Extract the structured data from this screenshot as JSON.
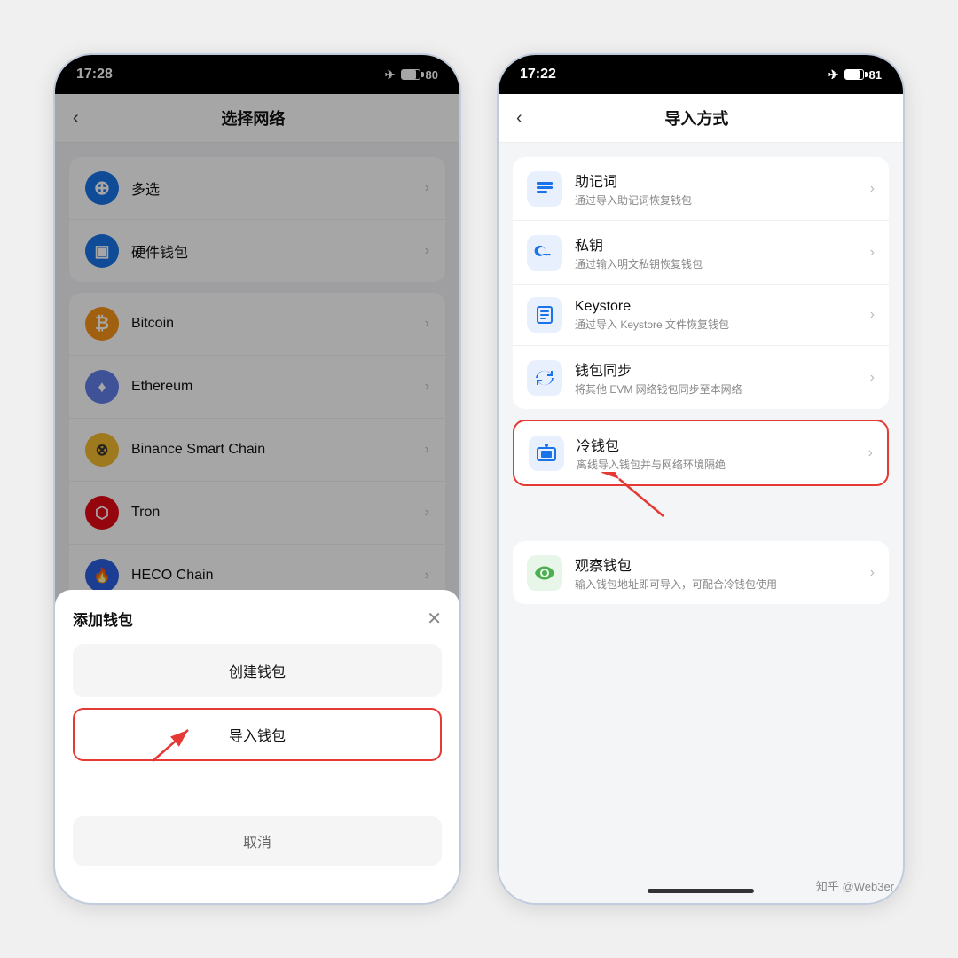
{
  "left_phone": {
    "status": {
      "time": "17:28",
      "battery": "80",
      "airplane": true
    },
    "nav_title": "选择网络",
    "back_label": "‹",
    "networks": [
      {
        "id": "multi",
        "label": "多选",
        "icon_bg": "#1a73e8",
        "icon_text": "⊕"
      },
      {
        "id": "hardware",
        "label": "硬件钱包",
        "icon_bg": "#1a73e8",
        "icon_text": "▣"
      },
      {
        "id": "bitcoin",
        "label": "Bitcoin",
        "icon_bg": "#f7931a",
        "icon_text": "₿"
      },
      {
        "id": "ethereum",
        "label": "Ethereum",
        "icon_bg": "#627eea",
        "icon_text": "♦"
      },
      {
        "id": "bsc",
        "label": "Binance Smart Chain",
        "icon_bg": "#f3ba2f",
        "icon_text": "⊗"
      },
      {
        "id": "tron",
        "label": "Tron",
        "icon_bg": "#e50915",
        "icon_text": "⬡"
      },
      {
        "id": "heco",
        "label": "HECO Chain",
        "icon_bg": "#2a5fe0",
        "icon_text": "🔥"
      }
    ],
    "bottom_sheet": {
      "title": "添加钱包",
      "create_label": "创建钱包",
      "import_label": "导入钱包",
      "cancel_label": "取消",
      "close_icon": "✕"
    }
  },
  "right_phone": {
    "status": {
      "time": "17:22",
      "battery": "81",
      "airplane": true
    },
    "nav_title": "导入方式",
    "back_label": "‹",
    "methods_group1": [
      {
        "id": "mnemonic",
        "title": "助记词",
        "desc": "通过导入助记词恢复钱包",
        "icon_bg": "#1a73e8",
        "icon_color": "#fff"
      },
      {
        "id": "privatekey",
        "title": "私钥",
        "desc": "通过输入明文私钥恢复钱包",
        "icon_bg": "#1a73e8",
        "icon_color": "#fff"
      },
      {
        "id": "keystore",
        "title": "Keystore",
        "desc": "通过导入 Keystore 文件恢复钱包",
        "icon_bg": "#1a73e8",
        "icon_color": "#fff"
      },
      {
        "id": "walletSync",
        "title": "钱包同步",
        "desc": "将其他 EVM 网络钱包同步至本网络",
        "icon_bg": "#1a73e8",
        "icon_color": "#fff"
      }
    ],
    "cold_wallet": {
      "id": "cold",
      "title": "冷钱包",
      "desc": "离线导入钱包并与网络环境隔绝",
      "icon_bg": "#1a73e8",
      "icon_color": "#fff",
      "highlighted": true
    },
    "watch_wallet": {
      "id": "watch",
      "title": "观察钱包",
      "desc": "输入钱包地址即可导入，可配合冷钱包使用",
      "icon_bg": "#4caf50",
      "icon_color": "#fff"
    }
  },
  "watermark": "知乎 @Web3er"
}
